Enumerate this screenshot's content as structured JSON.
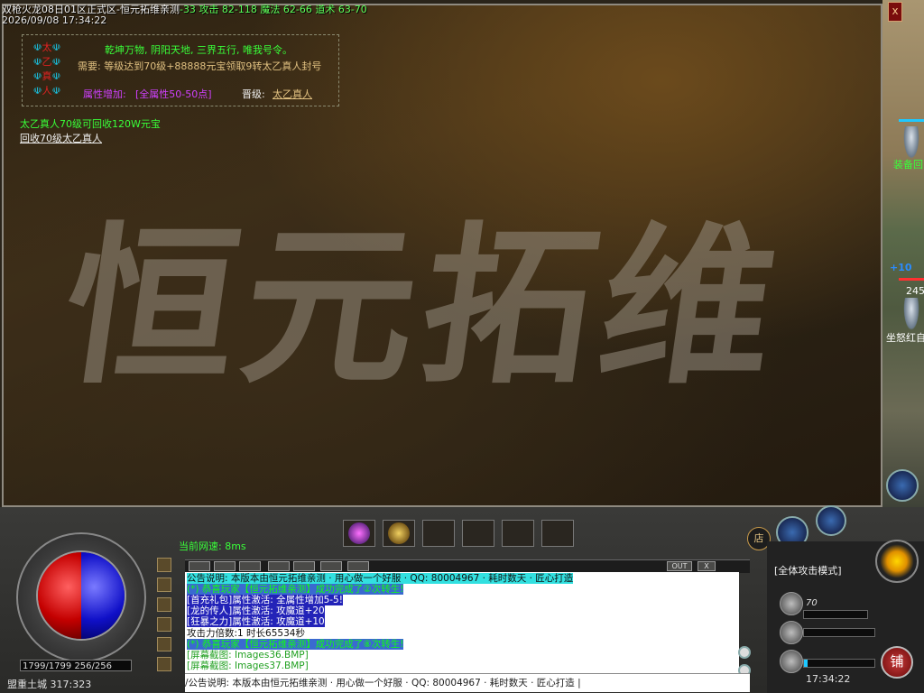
{
  "title_bar": {
    "server": "双枪火龙08日01区正式区-恒元拓维亲测",
    "stats": "-33  攻击 82-118  魔法 62-66  道术 63-70",
    "datetime": "2026/09/08 17:34:22",
    "close": "x"
  },
  "banner": {
    "calligraphy": "恒元拓维"
  },
  "info_box": {
    "emblem": [
      {
        "left": "☫",
        "mid": "太",
        "right": "☫"
      },
      {
        "left": "☫",
        "mid": "乙",
        "right": "☫"
      },
      {
        "left": "☫",
        "mid": "真",
        "right": "☫"
      },
      {
        "left": "☫",
        "mid": "人",
        "right": "☫"
      }
    ],
    "line1": "乾坤万物, 阴阳天地, 三界五行, 唯我号令。",
    "line2": "需要: 等级达到70级+88888元宝领取9转太乙真人封号",
    "attr_label": "属性增加:",
    "attr_value": "[全属性50-50点]",
    "promote_label": "晋级:",
    "promote_link": "太乙真人"
  },
  "recycle": {
    "note": "太乙真人70级可回收120W元宝",
    "link": "回收70级太乙真人"
  },
  "world": {
    "tag1": "装备回",
    "num1": "+10",
    "num2": "245",
    "tag2": "坐怒红自"
  },
  "hud": {
    "net_speed": "当前网速: 8ms",
    "hp_mp": "1799/1799  256/256",
    "map_coords": "盟重土城 317:323",
    "chat_out": "OUT",
    "chat_x": "X",
    "attack_mode": "[全体攻击模式]",
    "level": "70",
    "clock": "17:34:22",
    "shop_small": "店",
    "shop_big": "铺"
  },
  "chat": {
    "lines": [
      {
        "text": "公告说明: 本版本由恒元拓维亲测 · 用心做一个好服 · QQ: 80004967 · 耗时数天 · 匠心打造",
        "color": "#101010",
        "bg": "#32e0e0"
      },
      {
        "text": "(*) 恭喜玩家【恒元拓维亲测】成功完成了②次转生!",
        "color": "#10ff10",
        "bg": "#3a6ad0"
      },
      {
        "text": "[首充礼包]属性激活: 全属性增加5-5!",
        "color": "#ffffff",
        "bg": "#2323b8"
      },
      {
        "text": "[龙的传人]属性激活: 攻魔道+20",
        "color": "#ffffff",
        "bg": "#2323b8"
      },
      {
        "text": "[狂暴之力]属性激活: 攻魔道+10",
        "color": "#ffffff",
        "bg": "#2323b8"
      },
      {
        "text": "攻击力倍数:1 时长65534秒",
        "color": "#101010",
        "bg": "#ffffff"
      },
      {
        "text": "(*) 恭喜玩家【恒元拓维亲测】成功完成了⑧次转生!",
        "color": "#10ff10",
        "bg": "#3a6ad0"
      },
      {
        "text": "[屏幕截图: Images36.BMP]",
        "color": "#20a020",
        "bg": "#ffffff"
      },
      {
        "text": "[屏幕截图: Images37.BMP]",
        "color": "#20a020",
        "bg": "#ffffff"
      }
    ],
    "input": "/公告说明: 本版本由恒元拓维亲测 · 用心做一个好服 · QQ: 80004967 · 耗时数天 · 匠心打造 |"
  },
  "colors": {
    "green": "#39ff39",
    "cyan_link": "#19c6e6",
    "gold": "#e0c080",
    "yellow": "#ffd700"
  }
}
